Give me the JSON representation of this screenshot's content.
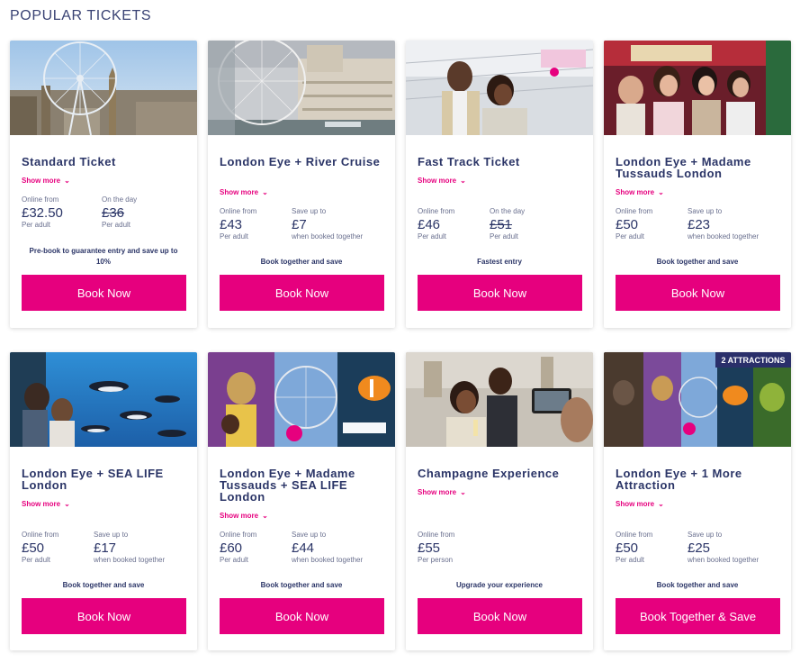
{
  "page": {
    "heading": "POPULAR TICKETS"
  },
  "colors": {
    "accent": "#e6007e",
    "text": "#2b3567"
  },
  "cards": [
    {
      "title": "Standard Ticket",
      "show_more": "Show more",
      "price_left": {
        "label": "Online from",
        "value": "£32.50",
        "sub": "Per adult"
      },
      "price_right": {
        "label": "On the day",
        "value": "£36",
        "sub": "Per adult",
        "struck": true
      },
      "note": "Pre-book to guarantee entry and save up to 10%",
      "button": "Book Now"
    },
    {
      "title": "London Eye + River Cruise",
      "show_more": "Show more",
      "price_left": {
        "label": "Online from",
        "value": "£43",
        "sub": "Per adult"
      },
      "price_right": {
        "label": "Save up to",
        "value": "£7",
        "sub": "when booked together"
      },
      "note": "Book together and save",
      "button": "Book Now"
    },
    {
      "title": "Fast Track Ticket",
      "show_more": "Show more",
      "price_left": {
        "label": "Online from",
        "value": "£46",
        "sub": "Per adult"
      },
      "price_right": {
        "label": "On the day",
        "value": "£51",
        "sub": "Per adult",
        "struck": true
      },
      "note": "Fastest entry",
      "button": "Book Now"
    },
    {
      "title": "London Eye + Madame Tussauds London",
      "show_more": "Show more",
      "price_left": {
        "label": "Online from",
        "value": "£50",
        "sub": "Per adult"
      },
      "price_right": {
        "label": "Save up to",
        "value": "£23",
        "sub": "when booked together"
      },
      "note": "Book together and save",
      "button": "Book Now"
    },
    {
      "title": "London Eye + SEA LIFE London",
      "show_more": "Show more",
      "price_left": {
        "label": "Online from",
        "value": "£50",
        "sub": "Per adult"
      },
      "price_right": {
        "label": "Save up to",
        "value": "£17",
        "sub": "when booked together"
      },
      "note": "Book together and save",
      "button": "Book Now"
    },
    {
      "title": "London Eye + Madame Tussauds + SEA LIFE London",
      "show_more": "Show more",
      "price_left": {
        "label": "Online from",
        "value": "£60",
        "sub": "Per adult"
      },
      "price_right": {
        "label": "Save up to",
        "value": "£44",
        "sub": "when booked together"
      },
      "note": "Book together and save",
      "button": "Book Now"
    },
    {
      "title": "Champagne Experience",
      "show_more": "Show more",
      "price_left": {
        "label": "Online from",
        "value": "£55",
        "sub": "Per person"
      },
      "price_right": null,
      "note": "Upgrade your experience",
      "button": "Book Now"
    },
    {
      "title": "London Eye + 1 More Attraction",
      "show_more": "Show more",
      "price_left": {
        "label": "Online from",
        "value": "£50",
        "sub": "Per adult"
      },
      "price_right": {
        "label": "Save up to",
        "value": "£25",
        "sub": "when booked together"
      },
      "note": "Book together and save",
      "button": "Book Together & Save",
      "image_badge": "2 ATTRACTIONS"
    }
  ],
  "images": {
    "card0": "london-skyline-with-eye-photo",
    "card1": "london-eye-and-county-hall-photo",
    "card2": "visitors-at-fast-track-entrance-photo",
    "card3": "visitors-with-wax-figures-photo",
    "card4": "children-at-penguin-tank-photo",
    "card5": "three-attractions-collage",
    "card6": "champagne-guests-photo",
    "card7": "attractions-collage"
  }
}
